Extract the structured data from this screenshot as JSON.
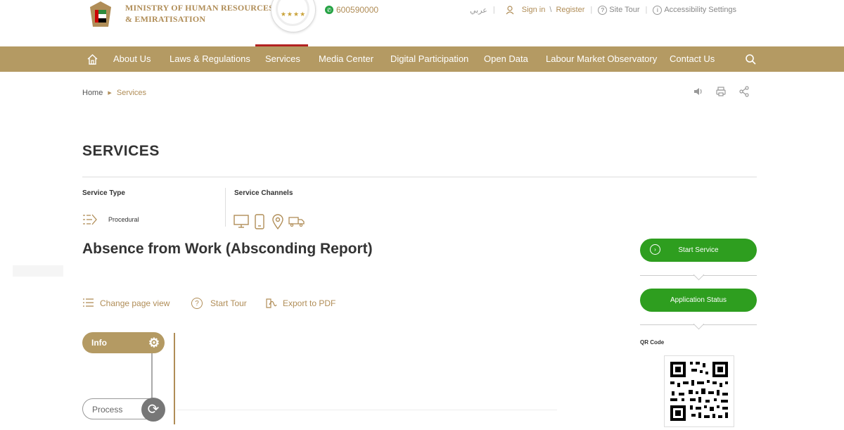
{
  "header": {
    "ministry_line1": "MINISTRY OF HUMAN RESOURCES",
    "ministry_line2": "& EMIRATISATION",
    "phone": "600590000",
    "lang": "عربي",
    "sign_in": "Sign in",
    "sign_sep": "\\",
    "register": "Register",
    "site_tour": "Site Tour",
    "accessibility": "Accessibility Settings",
    "rating_stars": "★★★★"
  },
  "nav": {
    "items": [
      "About Us",
      "Laws & Regulations",
      "Services",
      "Media Center",
      "Digital Participation",
      "Open Data",
      "Labour Market Observatory",
      "Contact Us"
    ],
    "active": "Services"
  },
  "breadcrumb": {
    "home": "Home",
    "current": "Services"
  },
  "page": {
    "title": "SERVICES",
    "service_type_label": "Service Type",
    "service_type_value": "Procedural",
    "service_channels_label": "Service Channels",
    "service_title": "Absence from Work (Absconding Report)",
    "actions": {
      "change_view": "Change page view",
      "start_tour": "Start Tour",
      "export_pdf": "Export to PDF"
    }
  },
  "sidebar": {
    "start_service": "Start Service",
    "application_status": "Application Status",
    "qr_label": "QR Code"
  },
  "timeline": {
    "info": "Info",
    "process": "Process"
  },
  "colors": {
    "gold": "#b49a63",
    "green": "#2e9e1f",
    "active_bar": "#b22222"
  },
  "icons": [
    "home-icon",
    "search-icon",
    "speaker-icon",
    "print-icon",
    "share-icon",
    "user-icon",
    "help-icon",
    "accessibility-icon",
    "whatsapp-icon",
    "gear-icon",
    "refresh-icon"
  ]
}
